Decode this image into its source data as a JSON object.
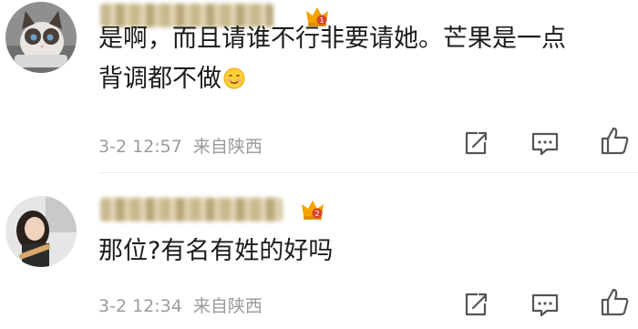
{
  "comments": [
    {
      "username": "",
      "rank_badge": "crown-1-icon",
      "content_line1": "是啊，而且请谁不行非要请她。芒果是一点",
      "content_line2": "背调都不做",
      "emoji": "smile-emoji",
      "time": "3-2 12:57",
      "location": "来自陕西"
    },
    {
      "username": "",
      "rank_badge": "crown-2-icon",
      "content_line1": "那位?有名有姓的好吗",
      "time": "3-2 12:34",
      "location": "来自陕西"
    }
  ],
  "colors": {
    "text": "#1b1b1b",
    "meta": "#9b9b9b",
    "crown": "#f2a500",
    "icon": "#555555"
  }
}
